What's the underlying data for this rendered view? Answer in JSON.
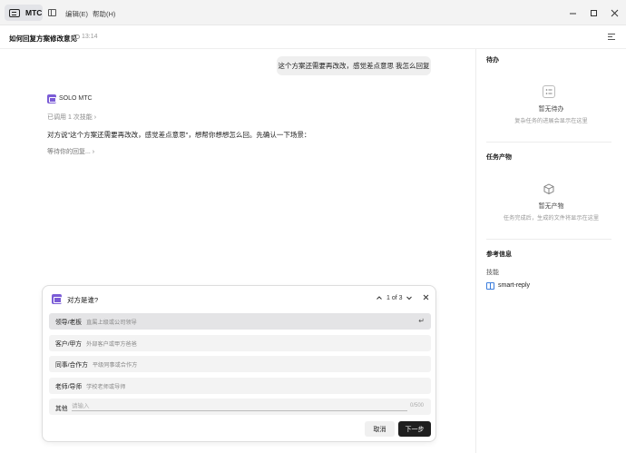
{
  "titlebar": {
    "app_name": "MTC",
    "menus": [
      "编辑(E)",
      "帮助(H)"
    ],
    "window_controls": [
      "minimize-icon",
      "maximize-icon",
      "close-icon"
    ]
  },
  "header": {
    "title": "如何回复方案修改意见",
    "time": "13:14"
  },
  "chat": {
    "user_message": "这个方案还需要再改改，感觉差点意思 我怎么回复",
    "bot_name": "SOLO MTC",
    "skill_used": "已调用 1 次技能",
    "bot_text": "对方说\"这个方案还需要再改改，感觉差点意思\"，想帮你想想怎么回。先确认一下场景：",
    "waiting": "等待你的回复..."
  },
  "right_panel": {
    "todo": {
      "title": "待办",
      "empty_title": "暂无待办",
      "empty_sub": "复杂任务的进展会显示在这里"
    },
    "outputs": {
      "title": "任务产物",
      "empty_title": "暂无产物",
      "empty_sub": "任务完成后，生成的文件将显示在这里"
    },
    "reference": {
      "title": "参考信息",
      "skills_label": "技能",
      "skill_name": "smart-reply"
    }
  },
  "dialog": {
    "question": "对方是谁?",
    "pager": "1 of 3",
    "options": [
      {
        "label": "领导/老板",
        "desc": "直属上级或公司领导",
        "selected": true
      },
      {
        "label": "客户/甲方",
        "desc": "外部客户或甲方爸爸",
        "selected": false
      },
      {
        "label": "同事/合作方",
        "desc": "平级同事或合作方",
        "selected": false
      },
      {
        "label": "老师/导师",
        "desc": "学校老师或导师",
        "selected": false
      }
    ],
    "other_label": "其他",
    "other_placeholder": "请输入",
    "char_count": "0/500",
    "cancel_label": "取消",
    "next_label": "下一步"
  },
  "colors": {
    "accent": "#7b5cd6",
    "link": "#3b7ddd",
    "primary_button": "#1f1f1f"
  }
}
